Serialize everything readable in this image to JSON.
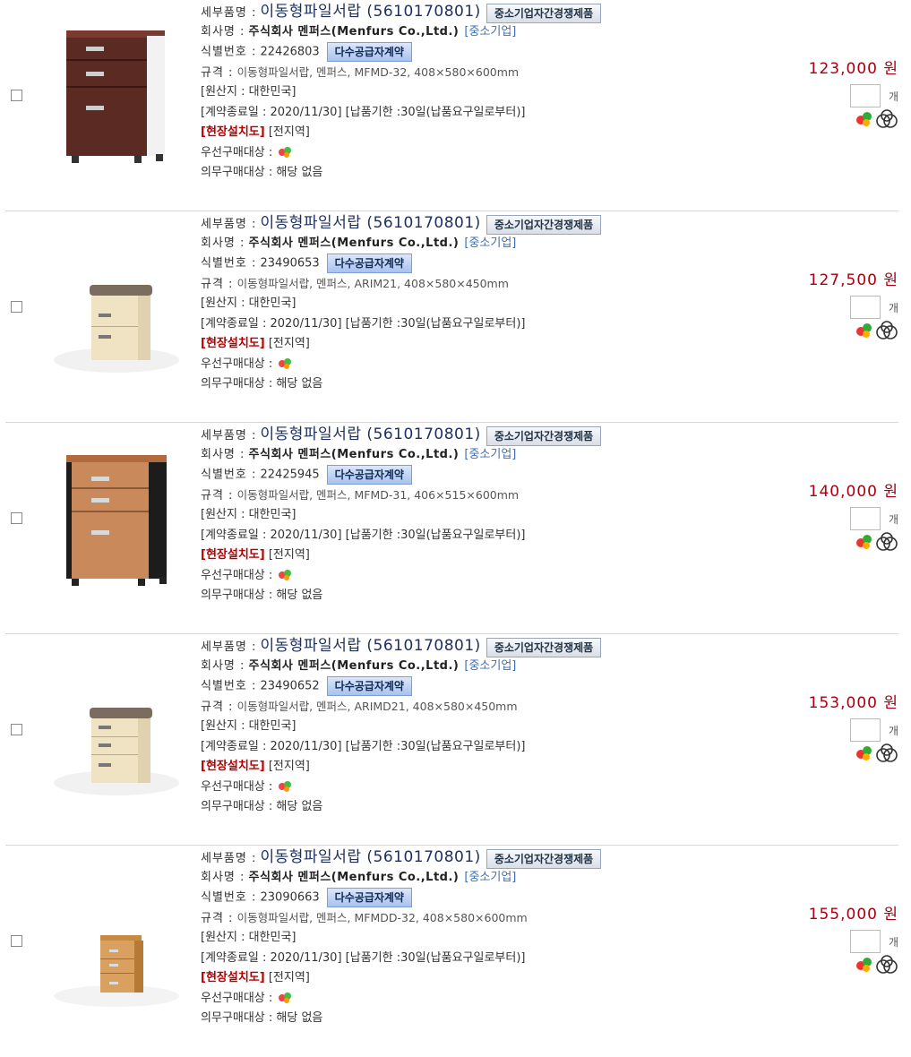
{
  "labels": {
    "detail_name": "세부품명 :",
    "company": "회사명 :",
    "id": "식별번호 :",
    "spec": "규격 :",
    "origin": "[원산지 : 대한민국]",
    "contract_end": "[계약종료일 : 2020/11/30]",
    "delivery": "[납품기한 :30일(납품요구일로부터)]",
    "install_red": "[현장설치도]",
    "install_area": "[전지역]",
    "priority": "우선구매대상 :",
    "mandatory": "의무구매대상 : 해당 없음",
    "unit": "개",
    "badge_competition": "중소기업자간경쟁제품",
    "badge_multi": "다수공급자계약",
    "company_name": "주식회사 멘퍼스(Menfurs Co.,Ltd.)",
    "sme_tag": "[중소기업]"
  },
  "products": [
    {
      "name": "이동형파일서랍 (5610170801)",
      "id": "22426803",
      "spec": "이동형파일서랍, 멘퍼스, MFMD-32, 408×580×600mm",
      "price": "123,000 원",
      "image": "wood-dark-cabinet"
    },
    {
      "name": "이동형파일서랍 (5610170801)",
      "id": "23490653",
      "spec": "이동형파일서랍, 멘퍼스, ARIM21, 408×580×450mm",
      "price": "127,500 원",
      "image": "cream-cabinet-cushion"
    },
    {
      "name": "이동형파일서랍 (5610170801)",
      "id": "22425945",
      "spec": "이동형파일서랍, 멘퍼스, MFMD-31, 406×515×600mm",
      "price": "140,000 원",
      "image": "teak-black-cabinet"
    },
    {
      "name": "이동형파일서랍 (5610170801)",
      "id": "23490652",
      "spec": "이동형파일서랍, 멘퍼스, ARIMD21, 408×580×450mm",
      "price": "153,000 원",
      "image": "cream-cabinet-cushion"
    },
    {
      "name": "이동형파일서랍 (5610170801)",
      "id": "23090663",
      "spec": "이동형파일서랍, 멘퍼스, MFMDD-32, 408×580×600mm",
      "price": "155,000 원",
      "image": "oak-small-cabinet"
    }
  ]
}
